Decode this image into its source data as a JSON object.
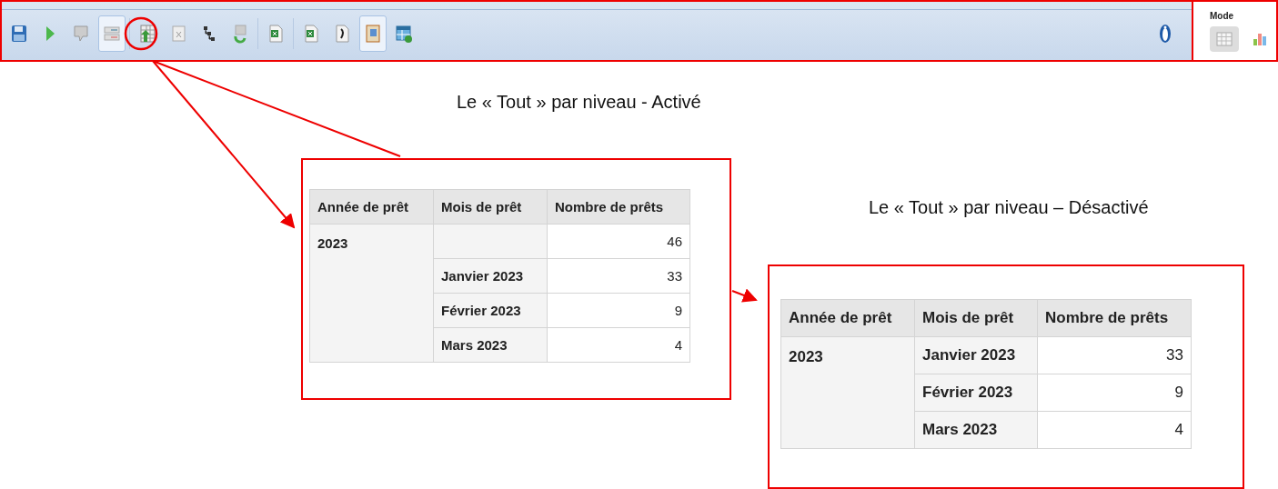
{
  "toolbar": {
    "buttons": [
      {
        "kind": "save",
        "selected": false
      },
      {
        "kind": "play",
        "selected": false
      },
      {
        "kind": "comment",
        "selected": false
      },
      {
        "kind": "layout",
        "selected": true
      },
      {
        "kind": "table-up",
        "selected": false
      },
      {
        "kind": "clear",
        "selected": false
      },
      {
        "kind": "steps",
        "selected": false
      },
      {
        "kind": "refresh",
        "selected": false
      },
      {
        "kind": "excel",
        "selected": false
      },
      {
        "kind": "excel",
        "selected": false
      },
      {
        "kind": "doc",
        "selected": false
      },
      {
        "kind": "book",
        "selected": true
      },
      {
        "kind": "grid-add",
        "selected": false
      }
    ],
    "info": {
      "kind": "info"
    }
  },
  "mode": {
    "label": "Mode",
    "options": [
      {
        "kind": "table",
        "selected": true
      },
      {
        "kind": "chart",
        "selected": false
      }
    ]
  },
  "examples": [
    {
      "caption": "Le « Tout » par niveau - Activé",
      "columns": [
        "Année de prêt",
        "Mois de prêt",
        "Nombre de prêts"
      ],
      "year": "2023",
      "total": "46",
      "rows": [
        {
          "month": "Janvier 2023",
          "count": "33"
        },
        {
          "month": "Février 2023",
          "count": "9"
        },
        {
          "month": "Mars 2023",
          "count": "4"
        }
      ]
    },
    {
      "caption": "Le « Tout » par niveau – Désactivé",
      "columns": [
        "Année de prêt",
        "Mois de prêt",
        "Nombre de prêts"
      ],
      "year": "2023",
      "rows": [
        {
          "month": "Janvier 2023",
          "count": "33"
        },
        {
          "month": "Février 2023",
          "count": "9"
        },
        {
          "month": "Mars 2023",
          "count": "4"
        }
      ]
    }
  ]
}
